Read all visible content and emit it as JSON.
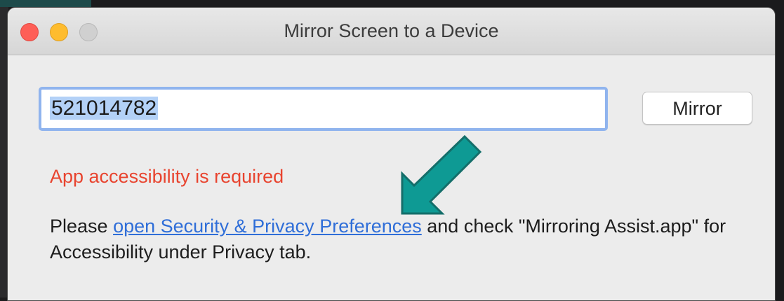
{
  "window": {
    "title": "Mirror Screen to a Device"
  },
  "form": {
    "code_value": "521014782",
    "mirror_label": "Mirror"
  },
  "message": {
    "error": "App accessibility is required",
    "prefix": "Please ",
    "link": "open Security & Privacy Preferences",
    "suffix": " and check \"Mirroring Assist.app\" for Accessibility under Privacy tab."
  },
  "colors": {
    "error": "#e8442f",
    "link": "#2f6ed8",
    "arrow": "#0e9a94",
    "focus_ring": "#90b4ee"
  },
  "icons": {
    "annotation": "teal-arrow-icon"
  }
}
